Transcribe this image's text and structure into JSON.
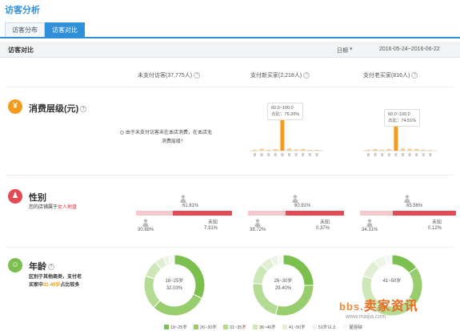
{
  "app": {
    "title": "访客分析"
  },
  "tabs": [
    {
      "label": "访客分布"
    },
    {
      "label": "访客对比"
    }
  ],
  "subhead": {
    "title": "访客对比",
    "date_label": "日期",
    "date_range": "2016-05-24~2016-06-22"
  },
  "columns": [
    {
      "label": "未支付访客(37,775人)"
    },
    {
      "label": "支付新买家(2,218人)"
    },
    {
      "label": "支付老买家(816人)"
    }
  ],
  "consumption": {
    "title": "消费层级(元)",
    "icon": "yen-icon",
    "color": "#f39b1e",
    "note": [
      "由于未支付访客未在本店消费，在本店无",
      "消费层级！"
    ],
    "new_tooltip": {
      "range": "60.0~100.0",
      "share_label": "占比：",
      "share": "75.20%"
    },
    "old_tooltip": {
      "range": "60.0~100.0",
      "share_label": "占比：",
      "share": "74.51%"
    },
    "new_bars": [
      0.03,
      0.06,
      0.02,
      0.05,
      1.0,
      0.07,
      0.04,
      0.05,
      0.02,
      0.02
    ],
    "old_bars": [
      0.03,
      0.05,
      0.03,
      0.05,
      1.0,
      0.07,
      0.06,
      0.05,
      0.03,
      0.02
    ]
  },
  "gender": {
    "title": "性别",
    "icon": "person-icon",
    "color": "#e34a56",
    "desc_prefix": "您的店铺属于",
    "desc_highlight": "女人地盘",
    "unknown_label": "未知",
    "groups": [
      {
        "female_pct": "61.81%",
        "female_value": 0.6181,
        "male_pct": "30.88%",
        "unknown_pct": "7.31%"
      },
      {
        "female_pct": "60.91%",
        "female_value": 0.6091,
        "male_pct": "38.72%",
        "unknown_pct": "0.37%"
      },
      {
        "female_pct": "65.56%",
        "female_value": 0.6556,
        "male_pct": "34.31%",
        "unknown_pct": "0.12%"
      }
    ]
  },
  "age": {
    "title": "年龄",
    "icon": "group-icon",
    "color": "#7bbf4e",
    "desc_line1": "区别于其他商类，支付老",
    "desc_line2_prefix": "买家中",
    "desc_line2_highlight": "31-40岁",
    "desc_line2_suffix": "占比较多",
    "donuts": [
      {
        "center_range": "18~25岁",
        "center_pct": "32.03%",
        "segments": [
          0.32,
          0.3,
          0.18,
          0.09,
          0.05,
          0.03,
          0.03
        ]
      },
      {
        "center_range": "26~30岁",
        "center_pct": "29.40%",
        "segments": [
          0.25,
          0.29,
          0.22,
          0.11,
          0.06,
          0.04,
          0.03
        ]
      },
      {
        "center_range": "41~50岁",
        "center_pct": "",
        "segments": [
          0.15,
          0.2,
          0.25,
          0.2,
          0.1,
          0.06,
          0.04
        ]
      }
    ],
    "legend": [
      {
        "label": "18~25岁",
        "color": "#7bbf4e"
      },
      {
        "label": "26~30岁",
        "color": "#98cd6e"
      },
      {
        "label": "31~35岁",
        "color": "#b4db93"
      },
      {
        "label": "36~40岁",
        "color": "#cde7b7"
      },
      {
        "label": "41~50岁",
        "color": "#e0efd3"
      },
      {
        "label": "51岁以上",
        "color": "#edf5e6"
      },
      {
        "label": "星座缺",
        "color": "#f6f9f3"
      }
    ]
  },
  "watermark": {
    "brand_prefix": "bbs.",
    "brand": "卖家资讯",
    "url": "www.maijia.com"
  }
}
